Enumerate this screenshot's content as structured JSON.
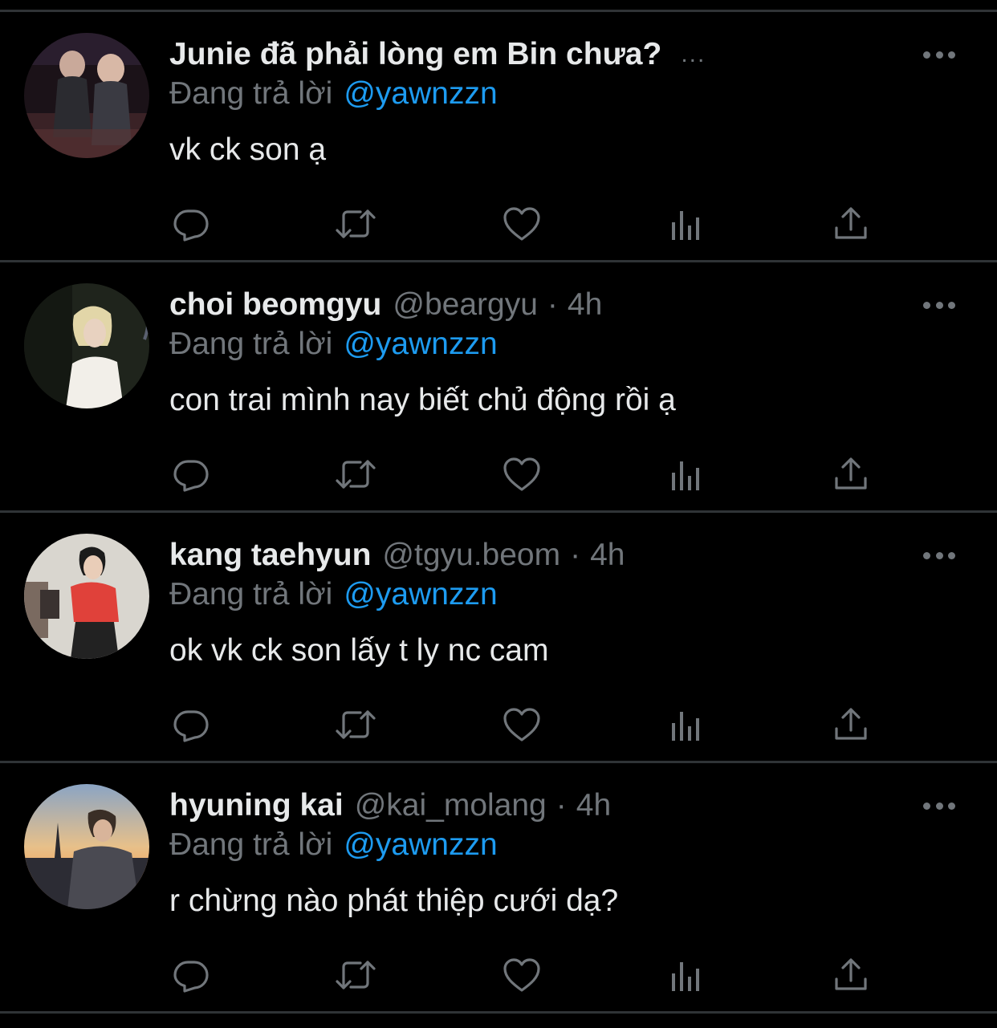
{
  "tweets": [
    {
      "display_name": "Junie đã phải lòng em Bin chưa?",
      "handle": "",
      "dot": "",
      "time": "",
      "truncation": "...",
      "reply_prefix": "Đang trả lời",
      "reply_to": "@yawnzzn",
      "text": "vk ck son ạ",
      "avatar_icon": "avatar-photo-two-people-at-event"
    },
    {
      "display_name": "choi beomgyu",
      "handle": "@beargyu",
      "dot": "·",
      "time": "4h",
      "truncation": "",
      "reply_prefix": "Đang trả lời",
      "reply_to": "@yawnzzn",
      "text": "con trai mình nay biết chủ động rồi ạ",
      "avatar_icon": "avatar-photo-blond-person-white-shirt"
    },
    {
      "display_name": "kang taehyun",
      "handle": "@tgyu.beom",
      "dot": "·",
      "time": "4h",
      "truncation": "",
      "reply_prefix": "Đang trả lời",
      "reply_to": "@yawnzzn",
      "text": "ok vk ck son lấy t ly nc cam",
      "avatar_icon": "avatar-photo-person-red-shirt"
    },
    {
      "display_name": "hyuning kai",
      "handle": "@kai_molang",
      "dot": "·",
      "time": "4h",
      "truncation": "",
      "reply_prefix": "Đang trả lời",
      "reply_to": "@yawnzzn",
      "text": "r chừng nào phát thiệp cưới dạ?",
      "avatar_icon": "avatar-photo-person-eiffel-sunset"
    }
  ],
  "icons": {
    "reply": "reply-bubble-icon",
    "retweet": "retweet-icon",
    "like": "heart-icon",
    "views": "bar-chart-icon",
    "share": "share-upload-icon",
    "more": "more-dots-icon"
  },
  "colors": {
    "background": "#000000",
    "text_primary": "#e7e9ea",
    "text_secondary": "#71767b",
    "accent": "#1d9bf0",
    "divider": "#2f3336"
  }
}
